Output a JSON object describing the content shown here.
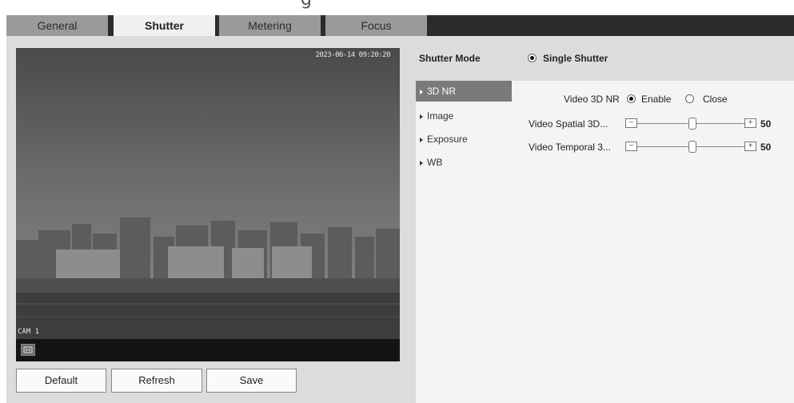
{
  "header": {
    "partial_title": "g"
  },
  "tabs": [
    {
      "label": "General",
      "active": false
    },
    {
      "label": "Shutter",
      "active": true
    },
    {
      "label": "Metering",
      "active": false
    },
    {
      "label": "Focus",
      "active": false
    }
  ],
  "video": {
    "timestamp": "2023-06-14 09:20:20",
    "channel": "CAM 1"
  },
  "buttons": {
    "default": "Default",
    "refresh": "Refresh",
    "save": "Save"
  },
  "shutter_mode": {
    "label": "Shutter Mode",
    "value": "Single Shutter"
  },
  "menu": [
    {
      "label": "3D NR",
      "active": true
    },
    {
      "label": "Image",
      "active": false
    },
    {
      "label": "Exposure",
      "active": false
    },
    {
      "label": "WB",
      "active": false
    }
  ],
  "settings": {
    "video_3d_nr": {
      "label": "Video 3D NR",
      "enable": "Enable",
      "close": "Close",
      "selected": "Enable"
    },
    "spatial": {
      "label": "Video Spatial 3D...",
      "value": "50"
    },
    "temporal": {
      "label": "Video Temporal 3...",
      "value": "50"
    }
  },
  "colors": {
    "tab_bar": "#2b2b2b",
    "tab_inactive": "#9a9a9a",
    "menu_active": "#7a7a7a",
    "panel": "#dcdcdc"
  }
}
